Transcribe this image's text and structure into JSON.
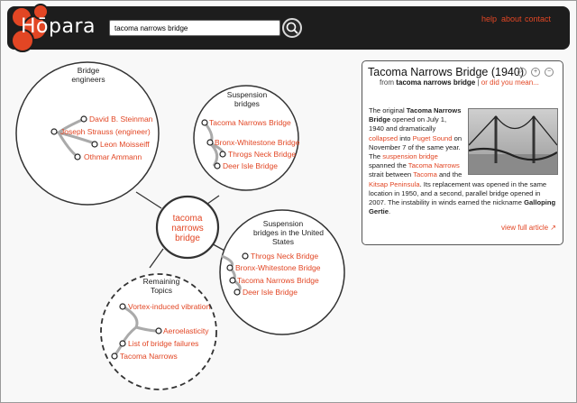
{
  "app": {
    "logo_text": "Hōpara",
    "colors": {
      "accent": "#e24624",
      "header_bg": "#1d1d1d"
    }
  },
  "search": {
    "value": "tacoma narrows bridge",
    "icon": "magnifier-icon"
  },
  "nav": {
    "help": "help",
    "about": "about",
    "contact": "contact"
  },
  "graph": {
    "center": {
      "line1": "tacoma",
      "line2": "narrows",
      "line3": "bridge"
    },
    "clusters": [
      {
        "title_line1": "Bridge",
        "title_line2": "engineers",
        "items": [
          "David B. Steinman",
          "Joseph Strauss (engineer)",
          "Leon Moisseiff",
          "Othmar Ammann"
        ]
      },
      {
        "title_line1": "Suspension",
        "title_line2": "bridges",
        "items": [
          "Tacoma Narrows Bridge",
          "Bronx-Whitestone Bridge",
          "Throgs Neck Bridge",
          "Deer Isle Bridge"
        ]
      },
      {
        "title_line1": "Suspension",
        "title_line2": "bridges in the United",
        "title_line3": "States",
        "items": [
          "Throgs Neck Bridge",
          "Bronx-Whitestone Bridge",
          "Tacoma Narrows Bridge",
          "Deer Isle Bridge"
        ]
      },
      {
        "title_line1": "Remaining",
        "title_line2": "Topics",
        "items": [
          "Vortex-induced vibration",
          "Aeroelasticity",
          "List of bridge failures",
          "Tacoma Narrows"
        ]
      }
    ]
  },
  "panel": {
    "title": "Tacoma Narrows Bridge (1940)",
    "controls": [
      "magnify-icon",
      "plus-icon",
      "minus-icon"
    ],
    "from_prefix": "from",
    "from_query": "tacoma narrows bridge",
    "from_sep": " | ",
    "from_alt": "or did you mean...",
    "article": {
      "t1": "The original ",
      "b1": "Tacoma Narrows Bridge",
      "t2": " opened on July 1, 1940 and dramatically ",
      "l1": "collapsed",
      "t3": " into ",
      "l2": "Puget Sound",
      "t4": " on November 7 of the same year. The ",
      "l3": "suspension bridge",
      "t5": " spanned the ",
      "l4": "Tacoma Narrows",
      "t6": " strait between ",
      "l5": "Tacoma",
      "t7": " and the ",
      "l6": "Kitsap Peninsula",
      "t8": ". Its replacement was opened in the same location in 1950, and a second, parallel bridge opened in 2007. The instability in winds earned the nickname ",
      "b2": "Galloping Gertie",
      "t9": "."
    },
    "view_full": "view full article"
  }
}
